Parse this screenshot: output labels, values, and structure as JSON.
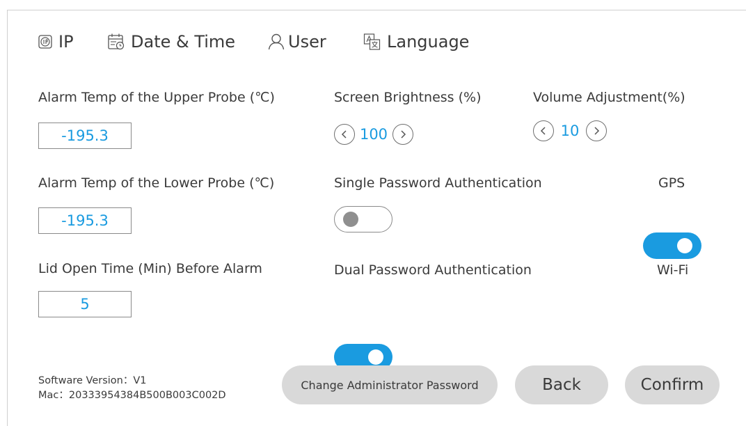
{
  "tabs": [
    {
      "label": "IP",
      "icon": "network-icon"
    },
    {
      "label": "Date & Time",
      "icon": "calendar-icon"
    },
    {
      "label": "User",
      "icon": "user-icon"
    },
    {
      "label": "Language",
      "icon": "language-icon"
    }
  ],
  "settings": {
    "upper_probe": {
      "label": "Alarm Temp of the Upper Probe (℃)",
      "value": "-195.3"
    },
    "lower_probe": {
      "label": "Alarm Temp of the Lower Probe (℃)",
      "value": "-195.3"
    },
    "lid_open": {
      "label": "Lid Open Time (Min) Before Alarm",
      "value": "5"
    },
    "brightness": {
      "label": "Screen Brightness (%)",
      "value": "100"
    },
    "volume": {
      "label": "Volume Adjustment(%)",
      "value": "10"
    },
    "single_password": {
      "label": "Single Password Authentication",
      "on": false
    },
    "dual_password": {
      "label": "Dual Password Authentication",
      "on": true
    },
    "gps": {
      "label": "GPS",
      "on": true
    },
    "wifi": {
      "label": "Wi-Fi",
      "on": true
    }
  },
  "footer": {
    "software_version": "Software Version：V1",
    "mac": "Mac：20333954384B500B003C002D",
    "change_password_label": "Change Administrator Password",
    "back_label": "Back",
    "confirm_label": "Confirm"
  },
  "colors": {
    "accent": "#1a9be0",
    "button_bg": "#d9d9d9",
    "text": "#3a3a3a"
  }
}
